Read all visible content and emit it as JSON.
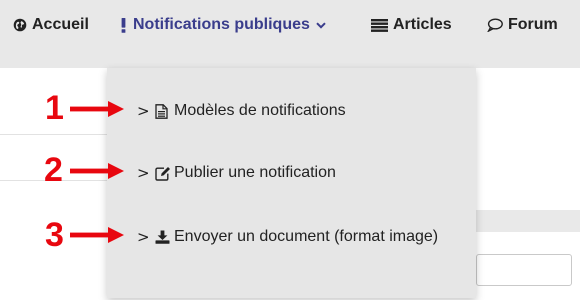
{
  "navbar": {
    "items": [
      {
        "label": "Accueil",
        "icon": "globe-icon"
      },
      {
        "label": "Notifications publiques",
        "icon": "exclamation-icon",
        "expanded": true
      },
      {
        "label": "Articles",
        "icon": "list-icon"
      },
      {
        "label": "Forum",
        "icon": "speech-bubble-icon"
      }
    ]
  },
  "dropdown": {
    "items": [
      {
        "caret": ">",
        "icon": "document-icon",
        "label": "Modèles de notifications"
      },
      {
        "caret": ">",
        "icon": "edit-icon",
        "label": "Publier une notification"
      },
      {
        "caret": ">",
        "icon": "download-icon",
        "label": "Envoyer un document (format image)"
      }
    ]
  },
  "callouts": [
    "1",
    "2",
    "3"
  ],
  "colors": {
    "navbar_bg": "#e8e8e8",
    "active_nav": "#3a3d8c",
    "dropdown_bg": "#e6e6e6",
    "callout_red": "#e8070f"
  }
}
